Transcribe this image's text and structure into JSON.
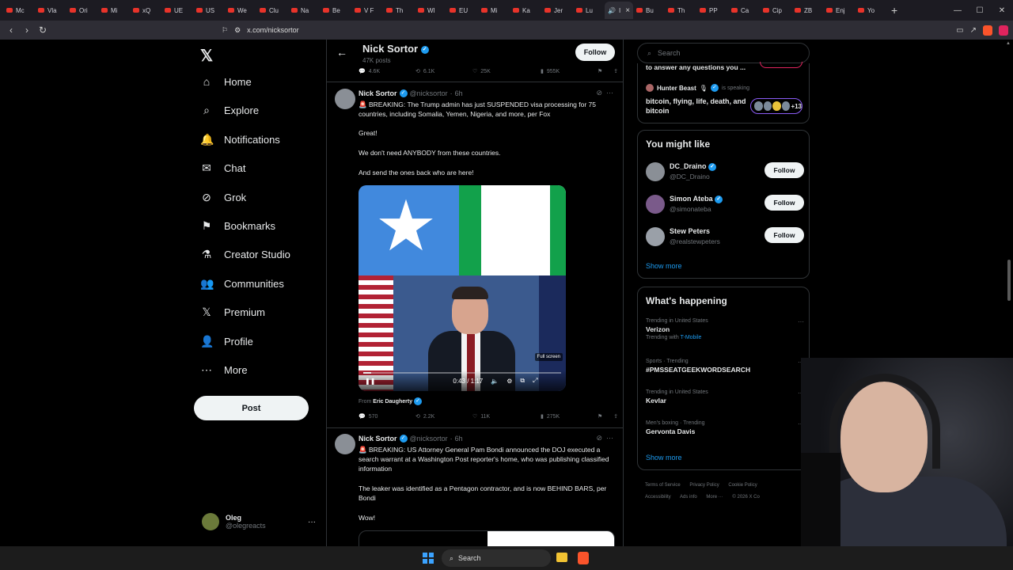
{
  "browser": {
    "tabs": [
      "Mc",
      "Vla",
      "Ori",
      "Mi",
      "xQ",
      "UE",
      "US",
      "We",
      "Clu",
      "Na",
      "Be",
      "V F",
      "Th",
      "WI",
      "EU",
      "Mi",
      "Ka",
      "Jer",
      "Lu",
      "I",
      "Bu",
      "Th",
      "PP",
      "Ca",
      "Cip",
      "ZB",
      "Enj",
      "Yo"
    ],
    "url": "x.com/nicksortor"
  },
  "nav": {
    "items": [
      {
        "label": "Home",
        "icon": "home-icon"
      },
      {
        "label": "Explore",
        "icon": "search-icon"
      },
      {
        "label": "Notifications",
        "icon": "bell-icon"
      },
      {
        "label": "Chat",
        "icon": "mail-icon"
      },
      {
        "label": "Grok",
        "icon": "grok-icon"
      },
      {
        "label": "Bookmarks",
        "icon": "bookmark-icon"
      },
      {
        "label": "Creator Studio",
        "icon": "flask-icon"
      },
      {
        "label": "Communities",
        "icon": "people-icon"
      },
      {
        "label": "Premium",
        "icon": "x-icon"
      },
      {
        "label": "Profile",
        "icon": "person-icon"
      },
      {
        "label": "More",
        "icon": "more-circle-icon"
      }
    ],
    "post_label": "Post",
    "account": {
      "name": "Oleg",
      "handle": "@olegreacts"
    }
  },
  "profile": {
    "name": "Nick Sortor",
    "posts": "47K posts",
    "follow_label": "Follow"
  },
  "prev_tweet_stats": {
    "replies": "4.6K",
    "reposts": "6.1K",
    "likes": "25K",
    "views": "955K"
  },
  "tweet1": {
    "name": "Nick Sortor",
    "handle": "@nicksortor",
    "time": "6h",
    "line1": "🚨 BREAKING: The Trump admin has just SUSPENDED visa processing for 75 countries, including Somalia, Yemen, Nigeria, and more, per Fox",
    "line2": "Great!",
    "line3": "We don't need ANYBODY from these countries.",
    "line4": "And send the ones back who are here!",
    "video_time": "0:43 / 1:17",
    "fullscreen_tip": "Full screen",
    "from_prefix": "From",
    "from_name": "Eric Daugherty",
    "replies": "570",
    "reposts": "2.2K",
    "likes": "11K",
    "views": "275K"
  },
  "tweet2": {
    "name": "Nick Sortor",
    "handle": "@nicksortor",
    "time": "6h",
    "line1": "🚨 BREAKING: US Attorney General Pam Bondi announced the DOJ executed a search warrant at a Washington Post reporter's home, who was publishing classified information",
    "line2": "The leaker was identified as a Pentagon contractor, and is now BEHIND BARS, per Bondi",
    "line3": "Wow!"
  },
  "sidebar": {
    "search_placeholder": "Search",
    "space_top": "to answer any questions you ...",
    "space_host": "Hunter Beast",
    "space_status": "is speaking",
    "space_title": "bitcoin, flying, life, death, and bitcoin",
    "space_count": "+13",
    "wtf_title": "You might like",
    "wtf": [
      {
        "name": "DC_Draino",
        "handle": "@DC_Draino",
        "follow": "Follow"
      },
      {
        "name": "Simon Ateba",
        "handle": "@simonateba",
        "follow": "Follow"
      },
      {
        "name": "Stew Peters",
        "handle": "@realstewpeters",
        "follow": "Follow"
      }
    ],
    "show_more": "Show more",
    "trending_title": "What's happening",
    "trends": [
      {
        "context": "Trending in United States",
        "name": "Verizon",
        "extra_prefix": "Trending with",
        "extra_link": "T-Mobile"
      },
      {
        "context": "Sports · Trending",
        "name": "#PMSSEATGEEKWORDSEARCH"
      },
      {
        "context": "Trending in United States",
        "name": "Kevlar"
      },
      {
        "context": "Men's boxing · Trending",
        "name": "Gervonta Davis"
      }
    ],
    "footer": [
      "Terms of Service",
      "Privacy Policy",
      "Cookie Policy",
      "Accessibility",
      "Ads info",
      "More ···",
      "© 2026 X Co"
    ]
  },
  "taskbar": {
    "search_label": "Search"
  }
}
